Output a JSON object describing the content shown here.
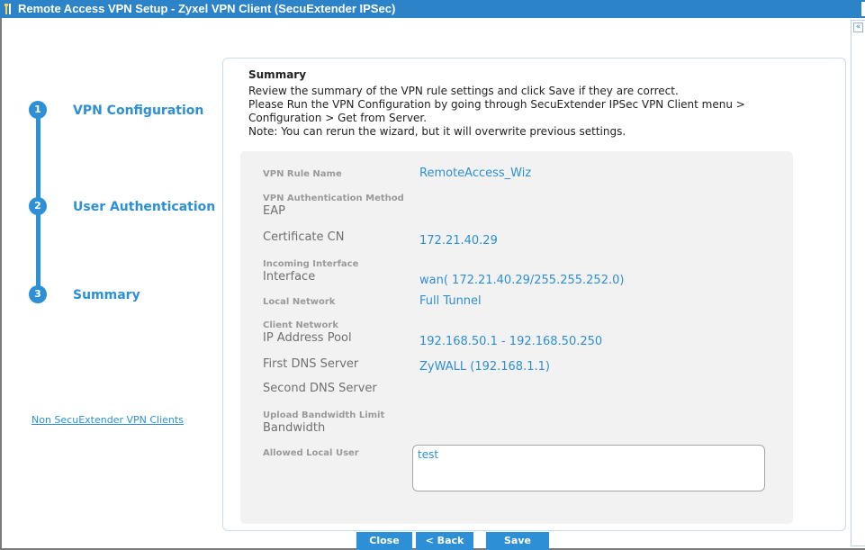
{
  "window": {
    "title": "Remote Access VPN Setup - Zyxel VPN Client (SecuExtender IPSec)",
    "icon": "tools-icon"
  },
  "steps": [
    {
      "number": "1",
      "label": "VPN Configuration"
    },
    {
      "number": "2",
      "label": "User Authentication"
    },
    {
      "number": "3",
      "label": "Summary"
    }
  ],
  "sidebar": {
    "link": "Non SecuExtender VPN Clients"
  },
  "summary": {
    "title": "Summary",
    "lines": [
      "Review the summary of the VPN rule settings and click Save if they are correct.",
      "Please Run the VPN Configuration by going through SecuExtender IPSec VPN Client menu >",
      "Configuration > Get from Server.",
      "Note: You can rerun the wizard, but it will overwrite previous settings."
    ]
  },
  "fields": {
    "rule_name": {
      "label": "VPN Rule Name",
      "value": "RemoteAccess_Wiz"
    },
    "auth_method": {
      "label1": "VPN Authentication Method",
      "label2": "EAP"
    },
    "cert_cn": {
      "label": "Certificate CN",
      "value": "172.21.40.29"
    },
    "interface": {
      "label1": "Incoming Interface",
      "label2": "Interface",
      "value": "wan( 172.21.40.29/255.255.252.0)"
    },
    "local_network": {
      "label": "Local Network",
      "value": "Full Tunnel"
    },
    "client_network": {
      "label1": "Client Network",
      "label2": "IP Address Pool",
      "value": "192.168.50.1 - 192.168.50.250"
    },
    "first_dns": {
      "label": "First DNS Server",
      "value": "ZyWALL (192.168.1.1)"
    },
    "second_dns": {
      "label": "Second DNS Server"
    },
    "upload_bw": {
      "label1": "Upload Bandwidth Limit",
      "label2": "Bandwidth"
    },
    "allowed_user": {
      "label": "Allowed Local User",
      "value": "test"
    }
  },
  "buttons": {
    "close": "Close",
    "back": "< Back",
    "save": "Save"
  },
  "colors": {
    "accent": "#2d8fd5",
    "titlebar": "#2d83c8"
  }
}
